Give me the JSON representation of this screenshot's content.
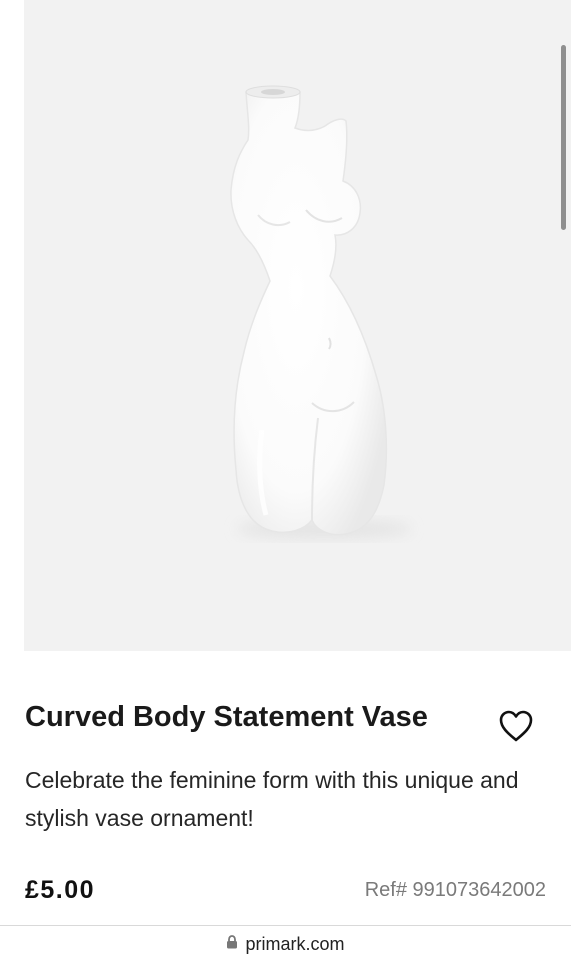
{
  "product": {
    "title": "Curved Body Statement Vase",
    "description": "Celebrate the feminine form with this unique and stylish vase ornament!",
    "price": "£5.00",
    "reference": "Ref# 991073642002",
    "image_icon": "vase-image",
    "wishlist_icon": "heart-icon"
  },
  "browser": {
    "url": "primark.com",
    "lock_icon": "lock-icon"
  },
  "colors": {
    "image_background": "#f2f2f2",
    "title_text": "#1a1a1a",
    "reference_text": "#7a7a7a"
  }
}
